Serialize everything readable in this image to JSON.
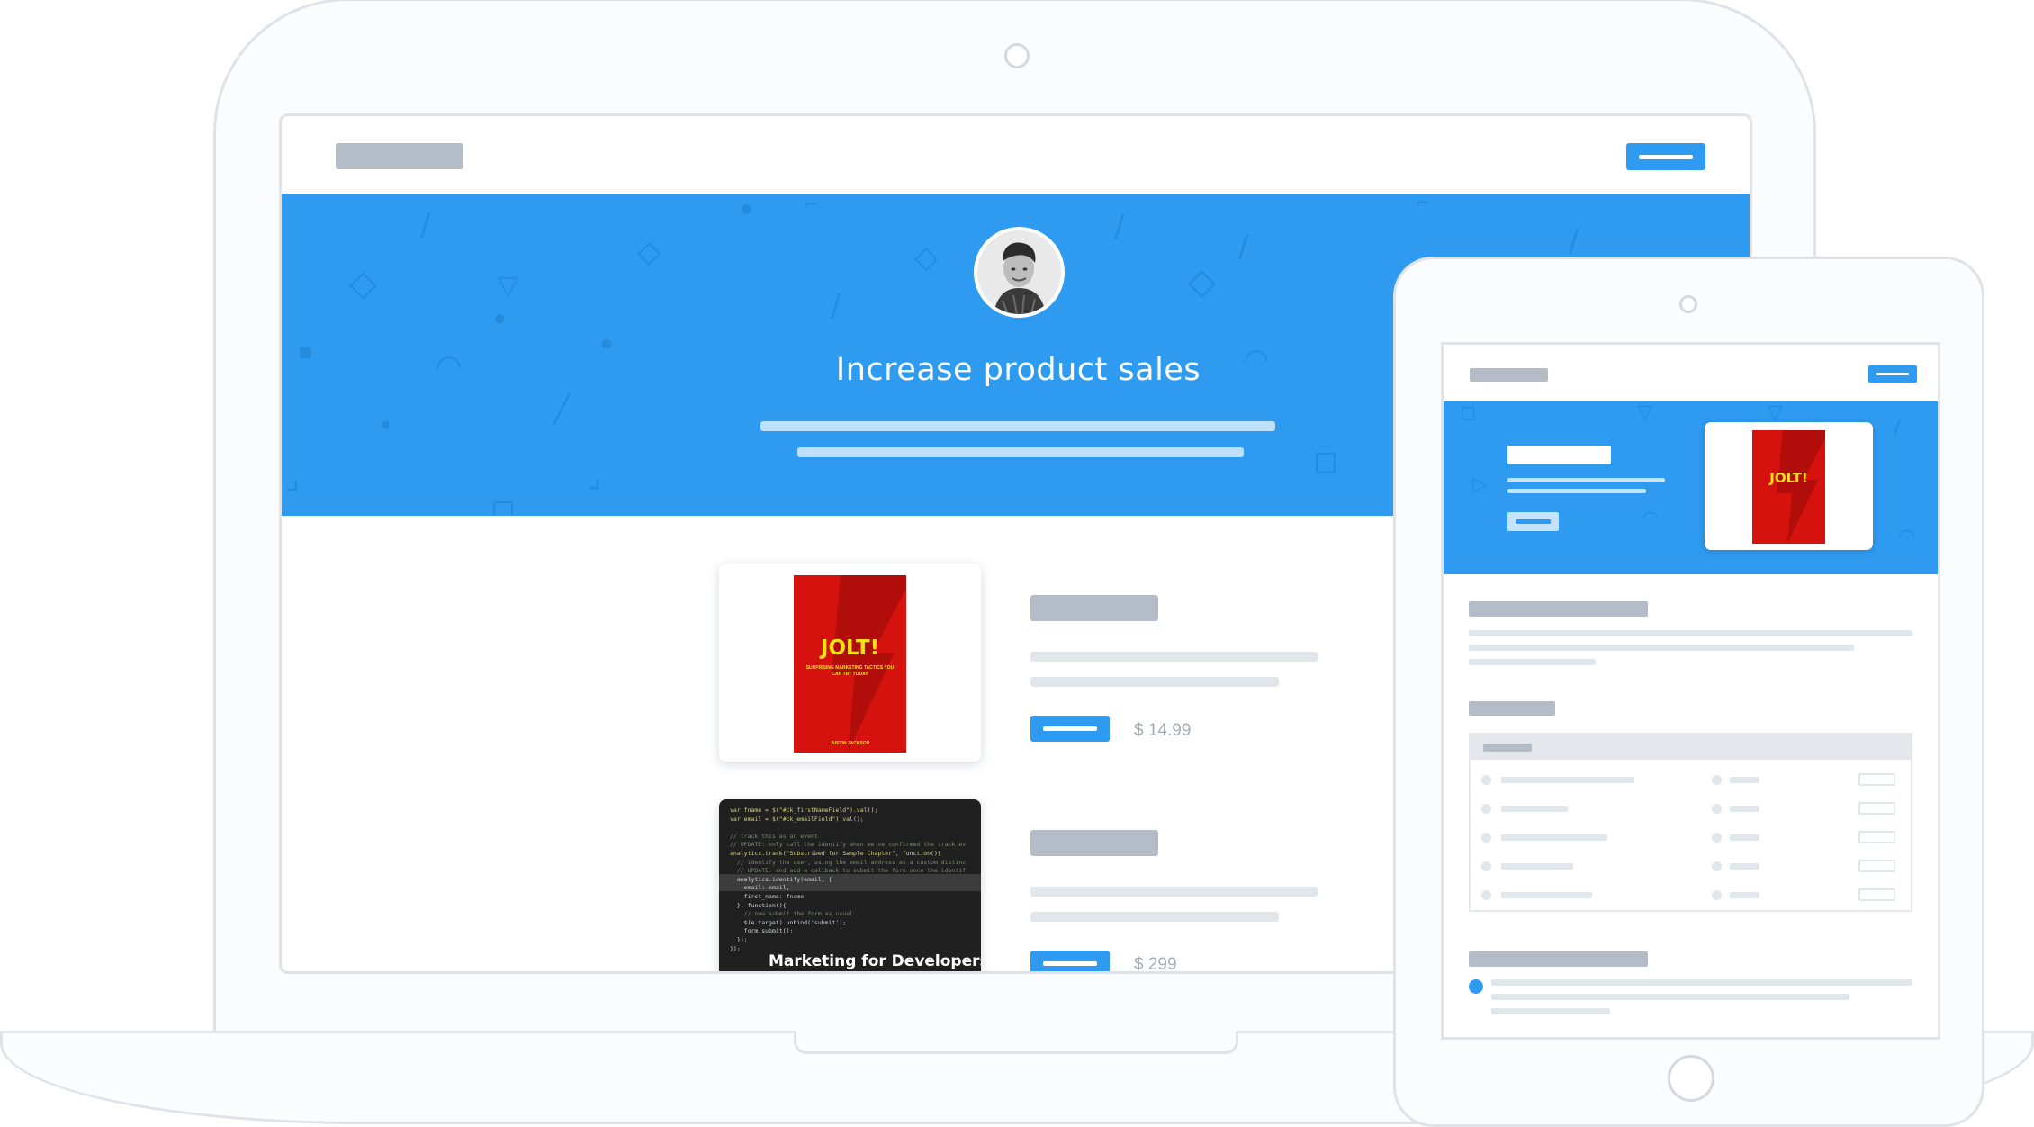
{
  "hero": {
    "title": "Increase product sales"
  },
  "products": [
    {
      "book_title": "JOLT!",
      "book_subtitle": "SURPRISING MARKETING TACTICS YOU CAN TRY TODAY",
      "book_author": "JUSTIN JACKSON",
      "price": "$ 14.99"
    },
    {
      "book_title": "Marketing for Developers",
      "price": "$ 299",
      "code_lines": [
        "var fname = $(\"#ck_firstNameField\").val();",
        "var email = $(\"#ck_emailField\").val();",
        "",
        "// track this as an event",
        "// UPDATE: only call the identify when we've confirmed the track ev",
        "analytics.track(\"Subscribed for Sample Chapter\", function(){",
        "  // identify the user, using the email address as a custom distinc",
        "  // UPDATE: and add a callback to submit the form once the identif",
        "  analytics.identify(email, {",
        "    email: email,",
        "    first_name: fname",
        "  }, function(){",
        "    // now submit the form as usual",
        "    $(e.target).unbind('submit');",
        "    form.submit();",
        "  });",
        "});"
      ]
    }
  ],
  "tablet": {
    "book_title": "JOLT!"
  },
  "colors": {
    "accent": "#2e9af0",
    "placeholder": "#b3bcc7",
    "line": "#e1e6eb",
    "book_red": "#d6120f",
    "book_yellow": "#f7e01a"
  }
}
